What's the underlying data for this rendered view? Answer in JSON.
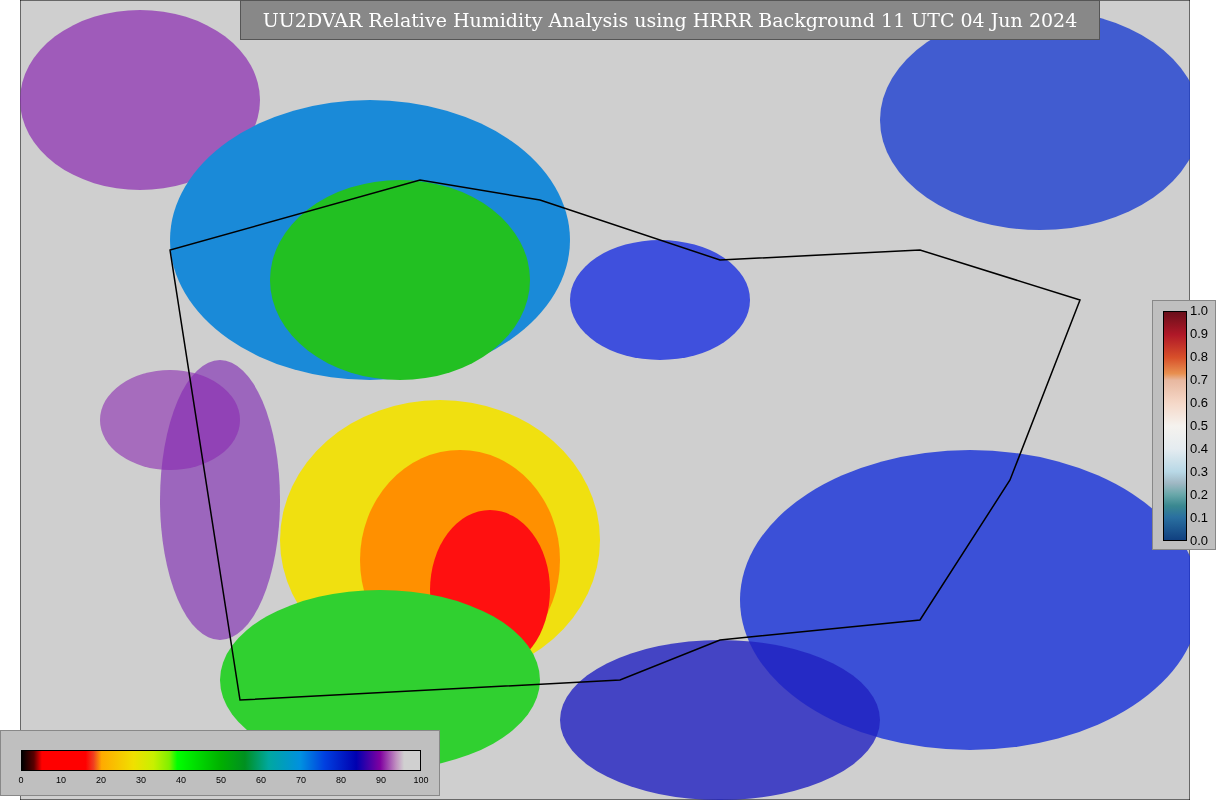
{
  "title": "UU2DVAR Relative Humidity Analysis using HRRR Background 11 UTC 04 Jun 2024",
  "humidity_colorbar": {
    "ticks": [
      "0",
      "10",
      "20",
      "30",
      "40",
      "50",
      "60",
      "70",
      "80",
      "90",
      "100"
    ]
  },
  "observation_colorbar": {
    "ticks": [
      "1.0",
      "0.9",
      "0.8",
      "0.7",
      "0.6",
      "0.5",
      "0.4",
      "0.3",
      "0.2",
      "0.1",
      "0.0"
    ]
  }
}
